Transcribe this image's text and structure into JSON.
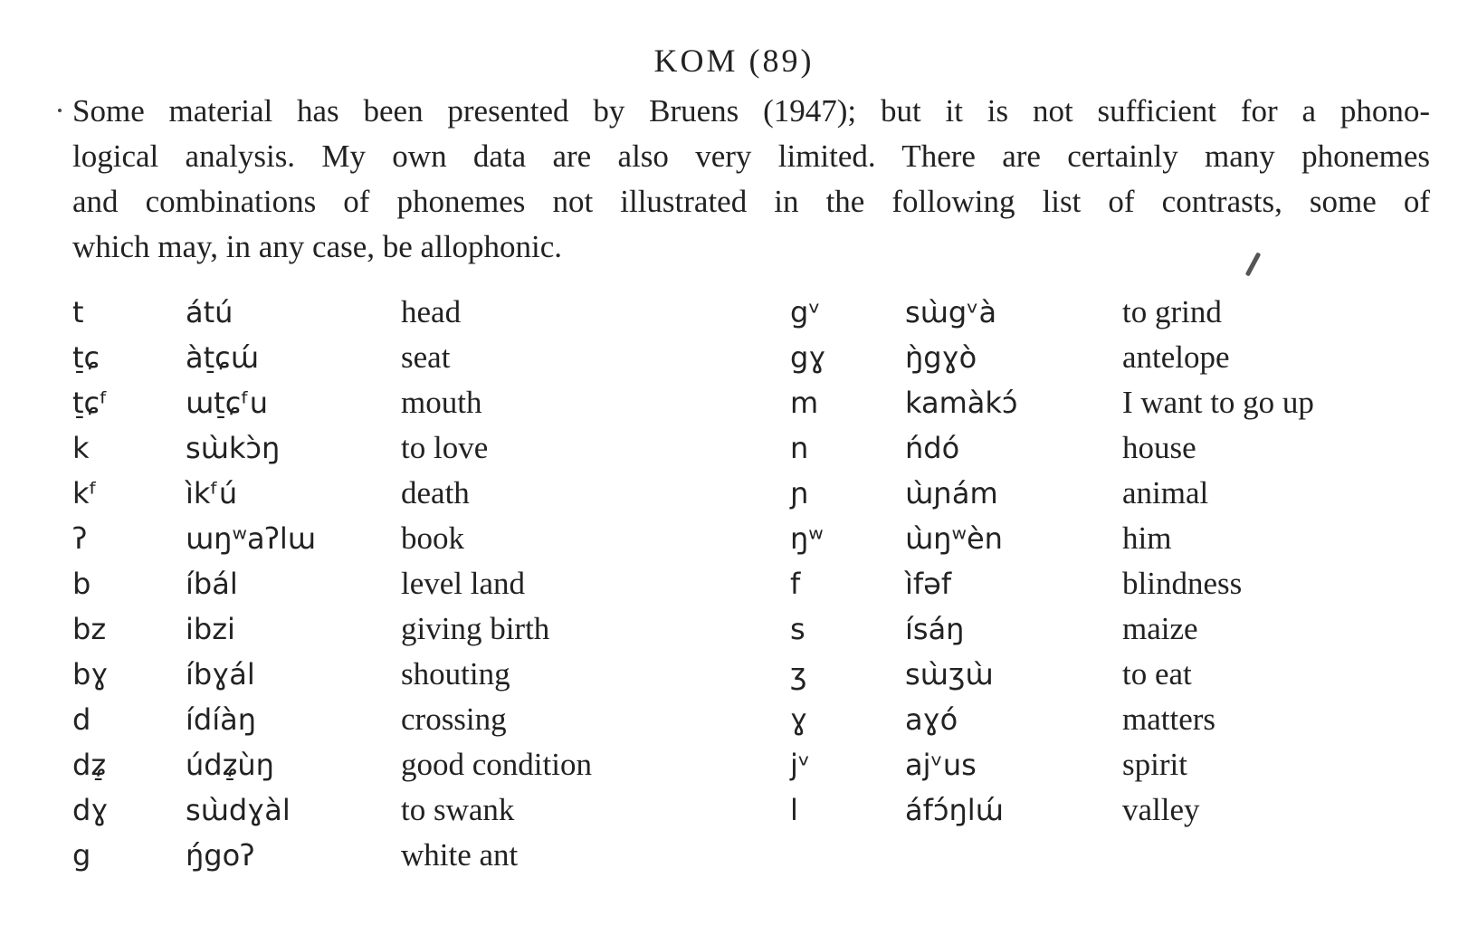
{
  "heading": "KOM (89)",
  "intro_lines": [
    "Some material has been presented by Bruens (1947); but it is not sufficient for a phono-",
    "logical analysis. My own data are also very limited. There are certainly many phonemes",
    "and combinations of phonemes not illustrated in the following list of contrasts, some of",
    "which may, in any case, be allophonic."
  ],
  "left_table": [
    {
      "phoneme": "t",
      "word": "átú",
      "gloss": "head"
    },
    {
      "phoneme": "t̠ɕ",
      "word": "àt̠ɕɯ́",
      "gloss": "seat"
    },
    {
      "phoneme": "t̠ɕᶠ",
      "word": "ɯt̠ɕᶠu",
      "gloss": "mouth"
    },
    {
      "phoneme": "k",
      "word": "sɯ̀kɔ̀ŋ",
      "gloss": "to love"
    },
    {
      "phoneme": "kᶠ",
      "word": "ìkᶠú",
      "gloss": "death"
    },
    {
      "phoneme": "ʔ",
      "word": "ɯŋʷaʔlɯ",
      "gloss": "book"
    },
    {
      "phoneme": "b",
      "word": "íbál",
      "gloss": "level land"
    },
    {
      "phoneme": "bz",
      "word": "ibzi",
      "gloss": "giving birth"
    },
    {
      "phoneme": "bɣ",
      "word": "íbɣál",
      "gloss": "shouting"
    },
    {
      "phoneme": "d",
      "word": "ídíàŋ",
      "gloss": "crossing"
    },
    {
      "phoneme": "dʑ̠",
      "word": "údʑ̠ùŋ",
      "gloss": "good condition"
    },
    {
      "phoneme": "dɣ",
      "word": "sɯ̀dɣàl",
      "gloss": "to swank"
    },
    {
      "phoneme": "g",
      "word": "ŋ́goʔ",
      "gloss": "white ant"
    }
  ],
  "right_table": [
    {
      "phoneme": "gᵛ",
      "word": "sɯ̀gᵛà",
      "gloss": "to grind"
    },
    {
      "phoneme": "gɣ",
      "word": "ŋ̀gɣò",
      "gloss": "antelope"
    },
    {
      "phoneme": "m",
      "word": "kamàkɔ́",
      "gloss": "I want to go up"
    },
    {
      "phoneme": "n",
      "word": "ńdó",
      "gloss": "house"
    },
    {
      "phoneme": "ɲ",
      "word": "ɯ̀ɲám",
      "gloss": "animal"
    },
    {
      "phoneme": "ŋʷ",
      "word": "ɯ̀ŋʷèn",
      "gloss": "him"
    },
    {
      "phoneme": "f",
      "word": "ìfəf",
      "gloss": "blindness"
    },
    {
      "phoneme": "s",
      "word": "ísáŋ",
      "gloss": "maize"
    },
    {
      "phoneme": "ʒ",
      "word": "sɯ̀ʒɯ̀",
      "gloss": "to eat"
    },
    {
      "phoneme": "ɣ",
      "word": "aɣó",
      "gloss": "matters"
    },
    {
      "phoneme": "jᵛ",
      "word": "ajᵛus",
      "gloss": "spirit"
    },
    {
      "phoneme": "l",
      "word": "áfɔ́ŋlɯ́",
      "gloss": "valley"
    }
  ]
}
